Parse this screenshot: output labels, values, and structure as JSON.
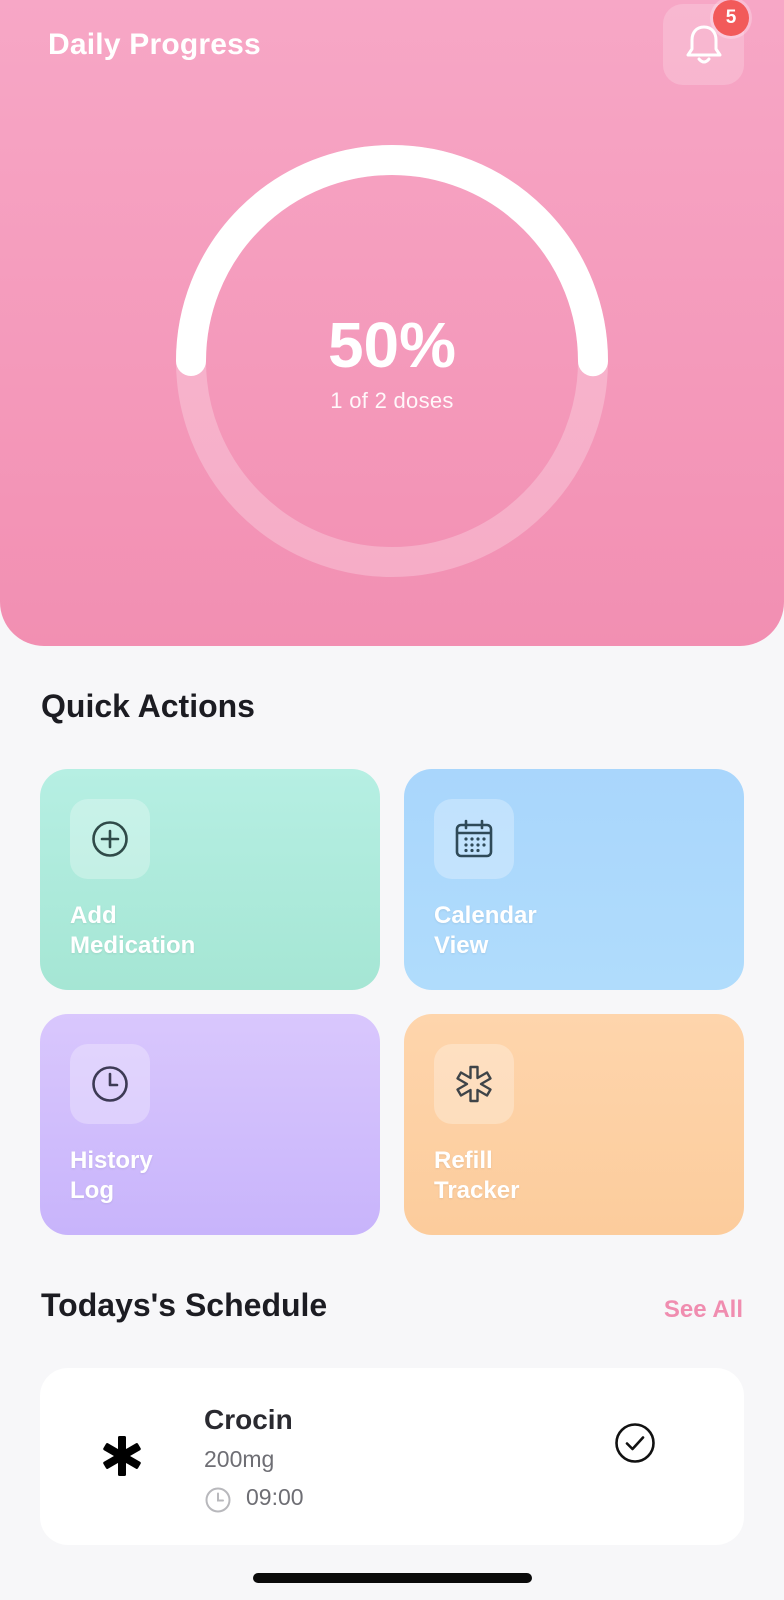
{
  "header": {
    "title": "Daily Progress",
    "notification_count": "5",
    "bell_icon": "bell-icon"
  },
  "progress": {
    "percent_label": "50%",
    "percent_value": 0.5,
    "subtitle": "1 of 2 doses"
  },
  "quick_actions": {
    "title": "Quick Actions",
    "items": [
      {
        "line1": "Add",
        "line2": "Medication",
        "icon": "plus-circle-icon",
        "color": "#b6efe3"
      },
      {
        "line1": "Calendar",
        "line2": "View",
        "icon": "calendar-icon",
        "color": "#a9d6fc"
      },
      {
        "line1": "History",
        "line2": "Log",
        "icon": "clock-icon",
        "color": "#d9c7fd"
      },
      {
        "line1": "Refill",
        "line2": "Tracker",
        "icon": "asterisk-icon",
        "color": "#fed5ac"
      }
    ]
  },
  "schedule": {
    "title": "Todays's Schedule",
    "see_all": "See All",
    "items": [
      {
        "name": "Crocin",
        "dose": "200mg",
        "time": "09:00",
        "taken": true
      }
    ]
  },
  "colors": {
    "accent_pink": "#f28fb2",
    "see_all": "#f08db0",
    "badge": "#f25a5a",
    "background": "#f7f7f9"
  }
}
